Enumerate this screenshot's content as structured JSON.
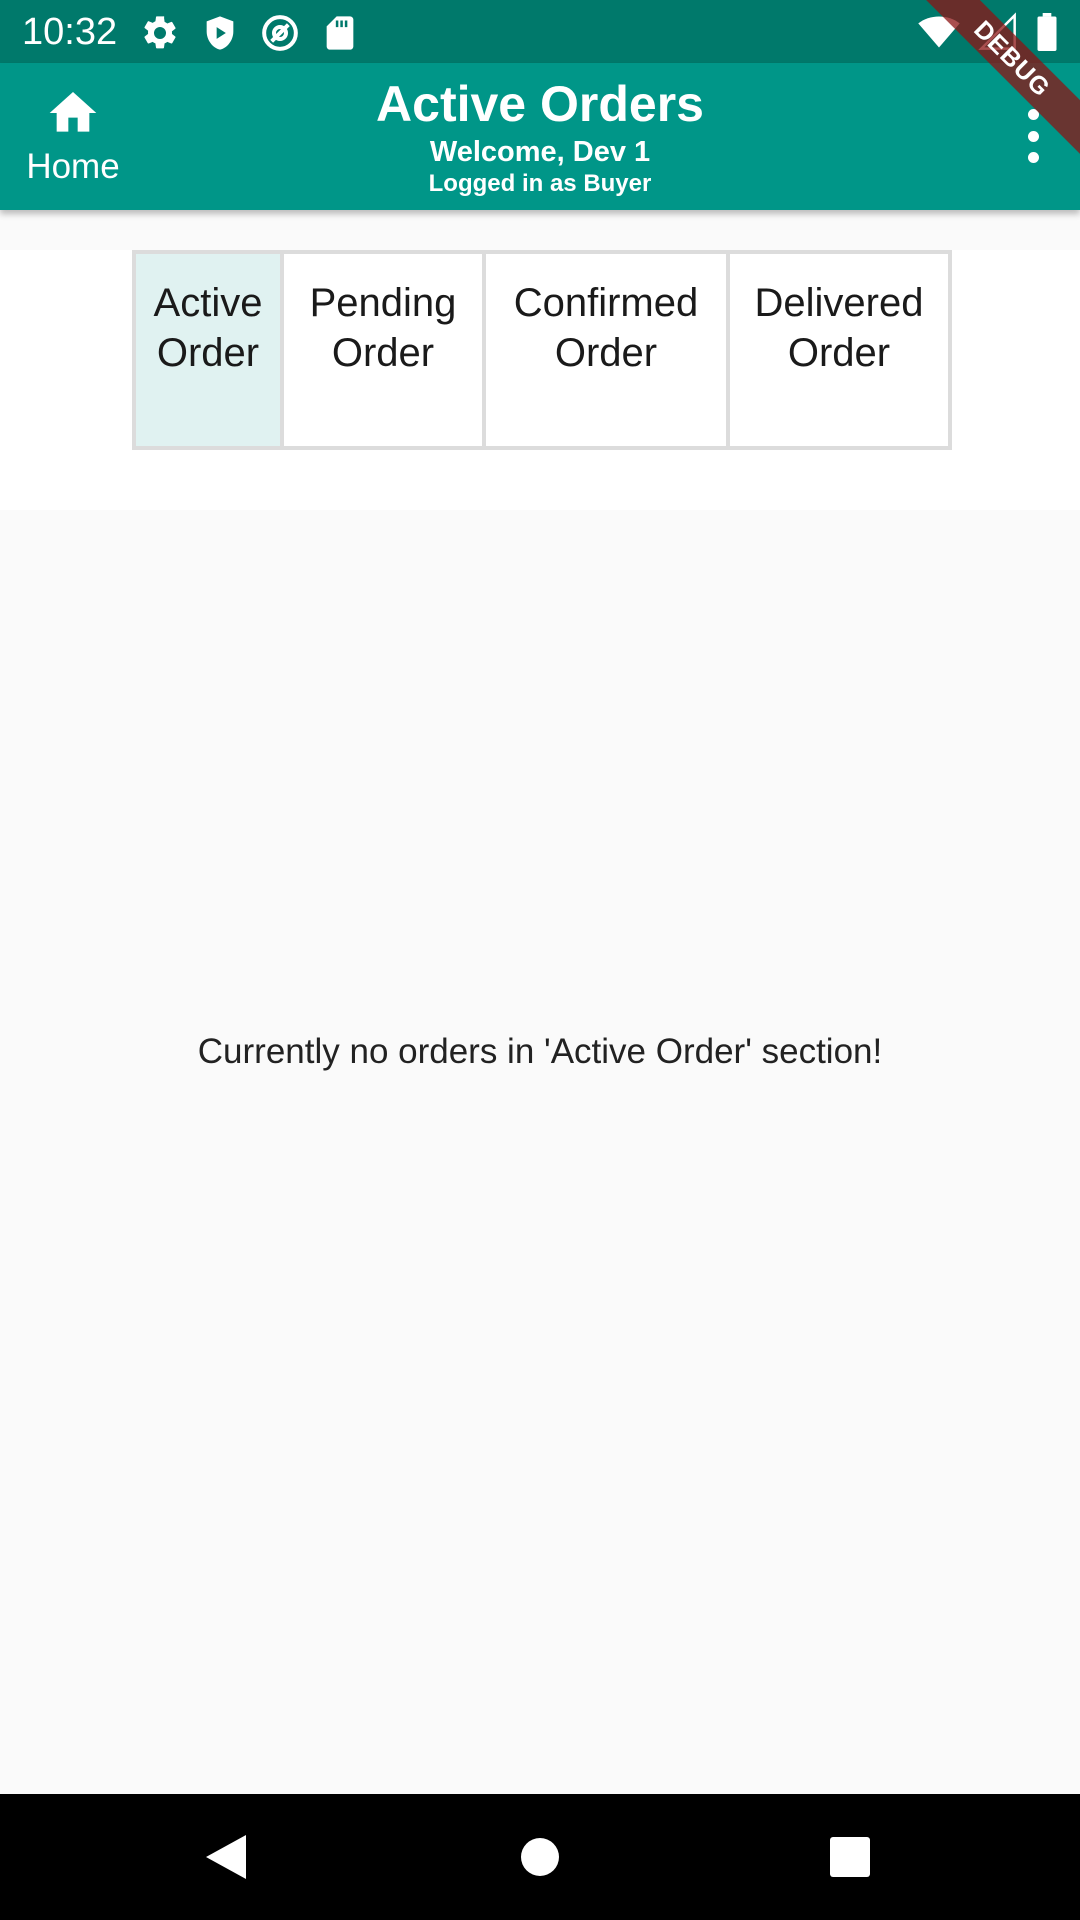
{
  "status_bar": {
    "time": "10:32",
    "left_icons": [
      "settings-icon",
      "shield-play-icon",
      "at-sign-icon",
      "sd-card-icon"
    ],
    "right_icons": [
      "wifi-icon",
      "signal-icon",
      "battery-icon"
    ]
  },
  "debug_banner": "DEBUG",
  "app_bar": {
    "home_label": "Home",
    "title": "Active Orders",
    "welcome": "Welcome, Dev 1",
    "logged_in": "Logged in as Buyer",
    "background": "#009688"
  },
  "tabs": [
    {
      "line1": "Active",
      "line2": "Order",
      "selected": true
    },
    {
      "line1": "Pending",
      "line2": "Order",
      "selected": false
    },
    {
      "line1": "Confirmed",
      "line2": "Order",
      "selected": false
    },
    {
      "line1": "Delivered",
      "line2": "Order",
      "selected": false
    }
  ],
  "empty_message": "Currently no orders in 'Active Order' section!",
  "nav_bar": {
    "buttons": [
      "back-icon",
      "home-circle-icon",
      "recents-icon"
    ]
  }
}
